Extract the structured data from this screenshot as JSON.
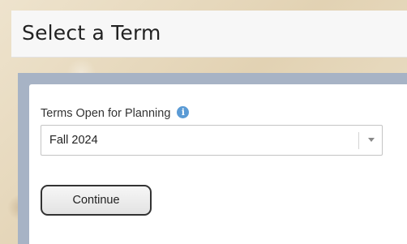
{
  "page": {
    "title": "Select a Term"
  },
  "term_field": {
    "label": "Terms Open for Planning",
    "info_icon": "info-circle-icon",
    "selected_value": "Fall 2024"
  },
  "actions": {
    "continue_label": "Continue"
  },
  "colors": {
    "info_icon": "#5b9bd5",
    "panel_frame": "#a7b3c5",
    "header_background": "#f7f7f7",
    "page_background": "#e9dcc3"
  }
}
